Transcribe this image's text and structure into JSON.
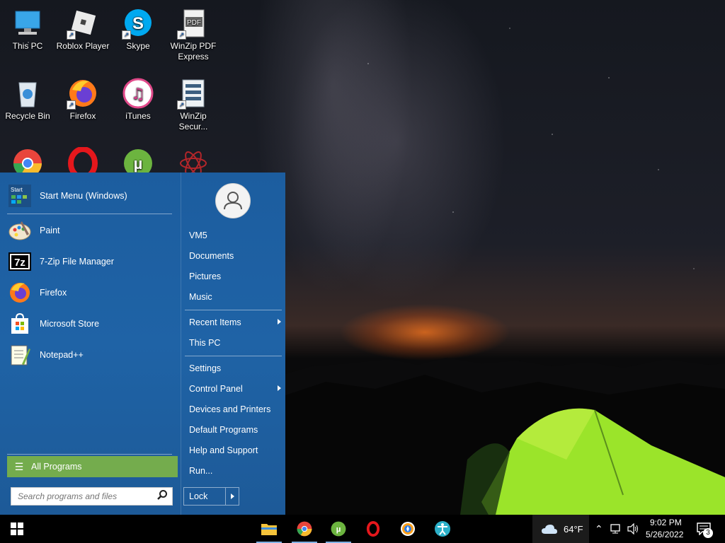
{
  "desktop": {
    "icons": [
      {
        "label": "This PC"
      },
      {
        "label": "Roblox Player"
      },
      {
        "label": "Skype"
      },
      {
        "label": "WinZip PDF Express",
        "glyph": "PDF"
      },
      {
        "label": "Recycle Bin"
      },
      {
        "label": "Firefox"
      },
      {
        "label": "iTunes"
      },
      {
        "label": "WinZip Secur..."
      }
    ]
  },
  "start_menu": {
    "header_item": {
      "label": "Start Menu (Windows)",
      "icon_text": "Start"
    },
    "programs": [
      {
        "label": "Paint"
      },
      {
        "label": "7-Zip File Manager",
        "icon_text": "7z"
      },
      {
        "label": "Firefox"
      },
      {
        "label": "Microsoft Store"
      },
      {
        "label": "Notepad++"
      }
    ],
    "all_programs": "All Programs",
    "search_placeholder": "Search programs and files",
    "right_items": {
      "user": "VM5",
      "documents": "Documents",
      "pictures": "Pictures",
      "music": "Music",
      "recent_items": "Recent Items",
      "this_pc": "This PC",
      "settings": "Settings",
      "control_panel": "Control Panel",
      "devices_printers": "Devices and Printers",
      "default_programs": "Default Programs",
      "help_support": "Help and Support",
      "run": "Run..."
    },
    "lock_label": "Lock"
  },
  "taskbar": {
    "weather_temp": "64°F",
    "time": "9:02 PM",
    "date": "5/26/2022",
    "notification_count": "3"
  },
  "colors": {
    "start_menu_bg": "#1f63a6",
    "all_programs_bg": "#74ac4d",
    "taskbar_bg": "#000000"
  }
}
